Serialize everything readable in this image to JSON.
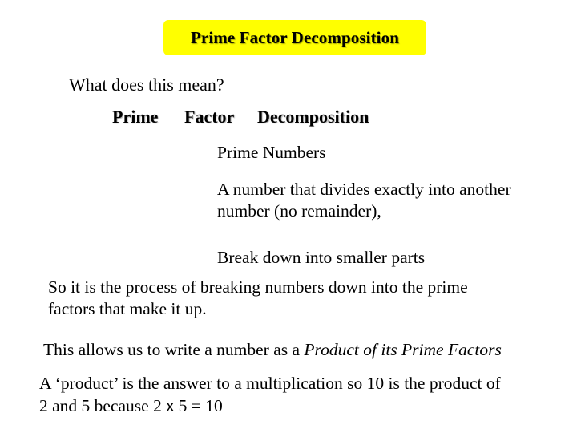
{
  "title": "Prime Factor Decomposition",
  "title_bg_color": "#ffff00",
  "question": "What does this mean?",
  "words": [
    "Prime",
    "Factor",
    "Decomposition"
  ],
  "definitions": {
    "prime": "Prime Numbers",
    "factor_line1": "A number that divides exactly into another",
    "factor_line2": "number (no remainder),",
    "decomposition": "Break down into smaller parts"
  },
  "summary": {
    "line1": "So it is the process of breaking numbers down into the prime",
    "line2": "factors that make it up."
  },
  "allows": {
    "prefix": "This allows us to write a number as a ",
    "emphasis": "Product of its Prime Factors"
  },
  "product_note": {
    "line1": "A ‘product’ is the answer to a multiplication so 10 is the product of",
    "line2_prefix": "2 and 5 because 2 ",
    "times_symbol": "x",
    "line2_suffix": " 5 = 10"
  }
}
